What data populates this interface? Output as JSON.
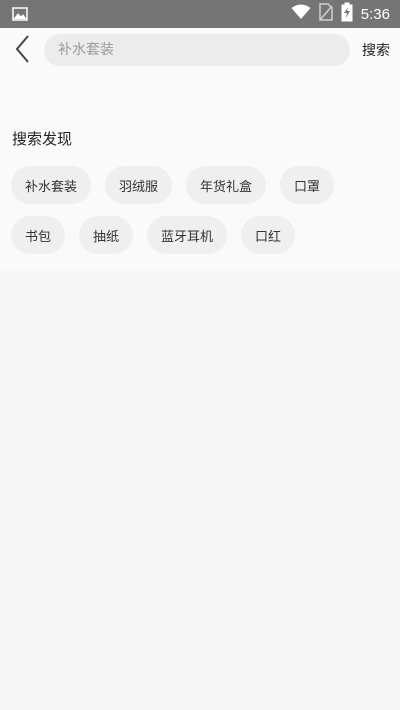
{
  "status_bar": {
    "time": "5:36",
    "icons": [
      "image-icon",
      "wifi-icon",
      "no-sim-icon",
      "battery-charging-icon"
    ]
  },
  "header": {
    "back_icon": "chevron-left-icon",
    "search_placeholder": "补水套装",
    "search_value": "",
    "search_button": "搜索"
  },
  "discover": {
    "title": "搜索发现",
    "tags": [
      "补水套装",
      "羽绒服",
      "年货礼盒",
      "口罩",
      "书包",
      "抽纸",
      "蓝牙耳机",
      "口红"
    ]
  },
  "colors": {
    "status_bar_bg": "#757575",
    "page_bg": "#f7f7f7",
    "search_box_bg": "#ececec",
    "tag_bg": "#efefef"
  }
}
